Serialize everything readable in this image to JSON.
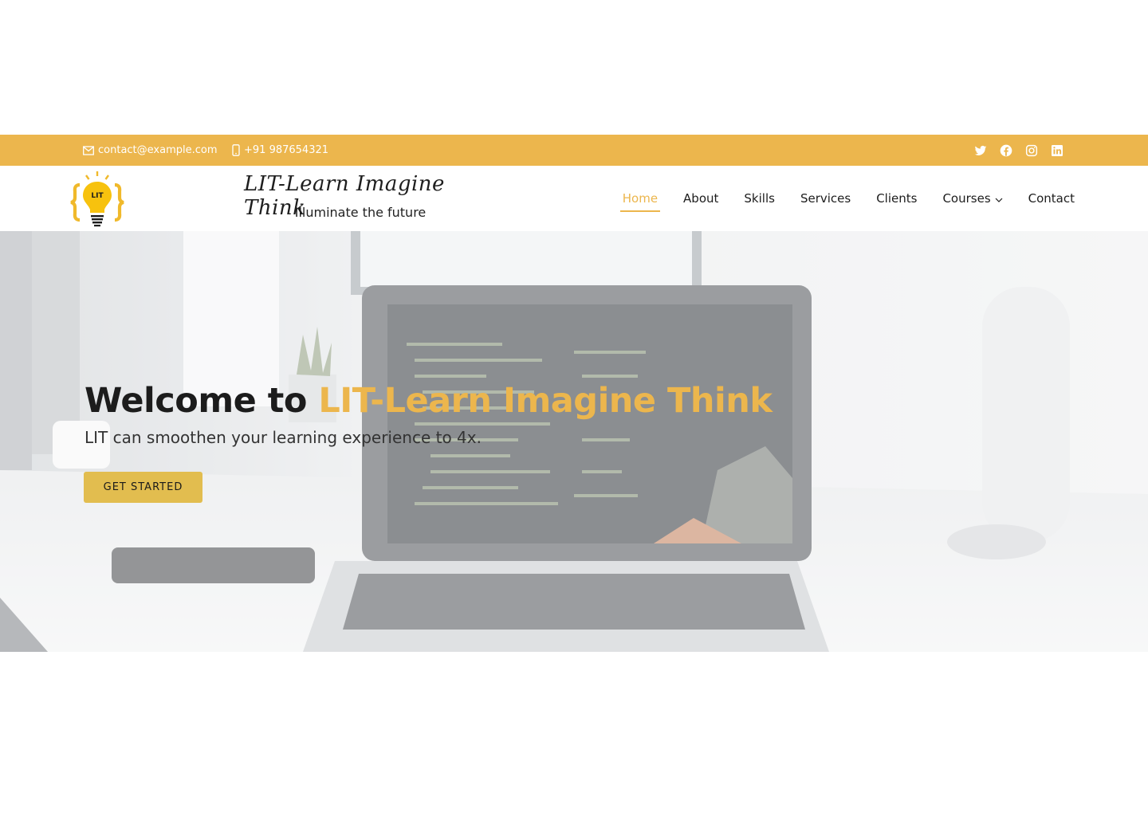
{
  "topbar": {
    "email": "contact@example.com",
    "phone": "+91 987654321",
    "socials": [
      "twitter-icon",
      "facebook-icon",
      "instagram-icon",
      "linkedin-icon"
    ]
  },
  "header": {
    "logo_text": "LIT",
    "brand_title": "LIT-Learn Imagine Think",
    "tagline": "Illuminate the future"
  },
  "nav": {
    "items": [
      {
        "label": "Home",
        "active": true
      },
      {
        "label": "About"
      },
      {
        "label": "Skills"
      },
      {
        "label": "Services"
      },
      {
        "label": "Clients"
      },
      {
        "label": "Courses",
        "dropdown": true
      },
      {
        "label": "Contact"
      }
    ]
  },
  "hero": {
    "title_prefix": "Welcome to ",
    "title_accent": "LIT-Learn Imagine Think",
    "subtitle": "LIT can smoothen your learning experience to 4x.",
    "cta": "GET STARTED"
  },
  "colors": {
    "accent": "#ecb64d",
    "button": "#e2bd4f",
    "text_dark": "#1c1c1c"
  }
}
